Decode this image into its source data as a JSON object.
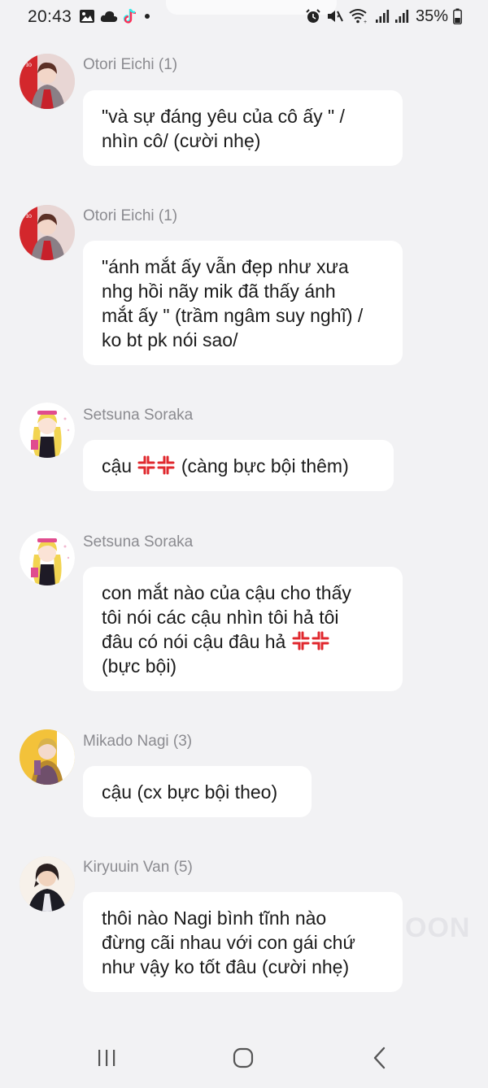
{
  "status_bar": {
    "time": "20:43",
    "battery_percent": "35%",
    "left_icons": [
      "gallery-icon",
      "cloud-icon",
      "tiktok-icon",
      "dot-icon"
    ],
    "right_icons": [
      "alarm-icon",
      "mute-icon",
      "wifi-icon",
      "signal-icon",
      "signal-icon",
      "battery-icon"
    ]
  },
  "messages": [
    {
      "sender": "Otori Eichi (1)",
      "lines": [
        "\"và sự đáng yêu của cô ấy \" /",
        "nhìn cô/ (cười nhẹ)"
      ]
    },
    {
      "sender": "Otori Eichi (1)",
      "lines": [
        "\"ánh mắt ấy vẫn đẹp như xưa",
        "nhg hồi nãy mik đã thấy ánh",
        "mắt ấy \" (trầm ngâm suy nghĩ) /",
        "ko bt pk nói sao/"
      ]
    },
    {
      "sender": "Setsuna Soraka",
      "line_before": "cậu",
      "line_after": "(càng bực bội thêm)"
    },
    {
      "sender": "Setsuna Soraka",
      "lines": [
        "con mắt nào của cậu cho thấy",
        "tôi nói các cậu nhìn tôi hả tôi"
      ],
      "line3": "đâu có nói cậu đâu hả",
      "line4": "(bực bội)"
    },
    {
      "sender": "Mikado Nagi (3)",
      "lines": [
        "cậu (cx bực bội theo)"
      ]
    },
    {
      "sender": "Kiryuuin Van (5)",
      "lines": [
        "thôi nào Nagi bình tĩnh nào",
        "đừng cãi nhau với con gái chứ",
        "như vậy ko tốt đâu (cười nhẹ)"
      ]
    }
  ],
  "watermark": "OON",
  "nav": {
    "recent": "recent-apps-icon",
    "home": "home-icon",
    "back": "back-icon"
  },
  "colors": {
    "background": "#f2f2f4",
    "bubble": "#ffffff",
    "sender_text": "#8b8b90",
    "message_text": "#1b1b1b",
    "anger_red": "#e0282e"
  }
}
